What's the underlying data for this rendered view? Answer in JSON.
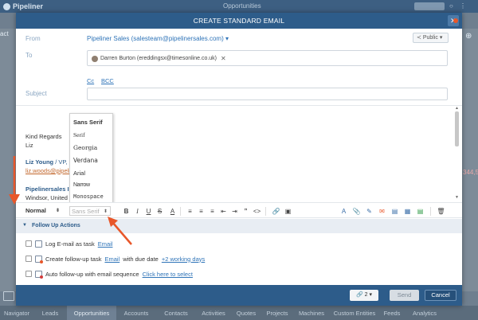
{
  "background": {
    "app_name": "Pipeliner",
    "page_title": "Opportunities",
    "left_stub": "act",
    "right_number": "344,5",
    "nav": [
      {
        "label": "Navigator",
        "active": false
      },
      {
        "label": "Leads",
        "active": false
      },
      {
        "label": "Opportunities",
        "active": true
      },
      {
        "label": "Accounts",
        "active": false
      },
      {
        "label": "Contacts",
        "active": false
      },
      {
        "label": "Activities",
        "active": false
      },
      {
        "label": "Quotes",
        "active": false
      },
      {
        "label": "Projects",
        "active": false
      },
      {
        "label": "Machines",
        "active": false
      },
      {
        "label": "Custom Entities",
        "active": false
      },
      {
        "label": "Feeds",
        "active": false
      },
      {
        "label": "Analytics",
        "active": false
      }
    ]
  },
  "modal": {
    "title": "CREATE STANDARD EMAIL",
    "from_label": "From",
    "from_value": "Pipeliner Sales (salesteam@pipelinersales.com) ▾",
    "visibility": "Public ▾",
    "to_label": "To",
    "to_chip": "Darren Burton (ereddingsx@timesonline.co.uk)",
    "cc_label": "Cc",
    "bcc_label": "BCC",
    "subject_label": "Subject",
    "subject_value": ""
  },
  "signature": {
    "regards": "Kind Regards",
    "first_name": "Liz",
    "name": "Liz Young",
    "role": " / VP, Gl",
    "email": "liz.woods@pipelin",
    "company": "Pipelinersales Inc",
    "address": "Windsor, United K"
  },
  "font_menu": {
    "items": [
      "Sans Serif",
      "Serif",
      "Georgia",
      "Verdana",
      "Arial",
      "Narrow",
      "Monospace"
    ]
  },
  "toolbar": {
    "paragraph_style": "Normal",
    "font_placeholder": "Sans Serif",
    "caret": "⬍",
    "buttons": [
      "B",
      "I",
      "U",
      "S",
      "A",
      "≡",
      "≡",
      "≡",
      "⇤",
      "⇥",
      "”",
      "<>",
      "🔗",
      "▣"
    ],
    "right_buttons": [
      "A",
      "📎",
      "✎",
      "✉",
      "▤",
      "▦",
      "▤",
      "🗑"
    ]
  },
  "follow_up": {
    "title": "Follow Up Actions",
    "row1_text": "Log E-mail as task",
    "row1_link": "Email",
    "row2_text": "Create follow-up task",
    "row2_link": "Email",
    "row2_mid": "with due date",
    "row2_link2": "+2 working days",
    "row3_text": "Auto follow-up with email sequence",
    "row3_link": "Click here to select"
  },
  "footer": {
    "attachments": "🔗 2 ▾",
    "send": "Send",
    "cancel": "Cancel"
  },
  "colors": {
    "header": "#2d5c8a",
    "accent": "#e8572a",
    "link": "#2f74b8"
  }
}
